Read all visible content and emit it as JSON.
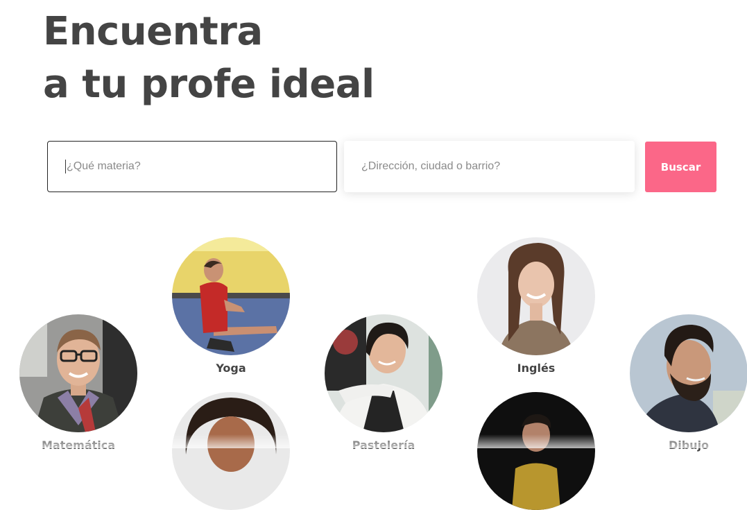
{
  "hero": {
    "line1": "Encuentra",
    "line2": "a tu profe ideal"
  },
  "search": {
    "subject_placeholder": "¿Qué materia?",
    "address_placeholder": "¿Dirección, ciudad o barrio?",
    "button_label": "Buscar"
  },
  "teachers": [
    {
      "subject": "Matemática"
    },
    {
      "subject": "Yoga"
    },
    {
      "subject": "Pastelería"
    },
    {
      "subject": "Inglés"
    },
    {
      "subject": "Dibujo"
    }
  ],
  "colors": {
    "accent": "#fb6788",
    "heading": "#444444"
  }
}
